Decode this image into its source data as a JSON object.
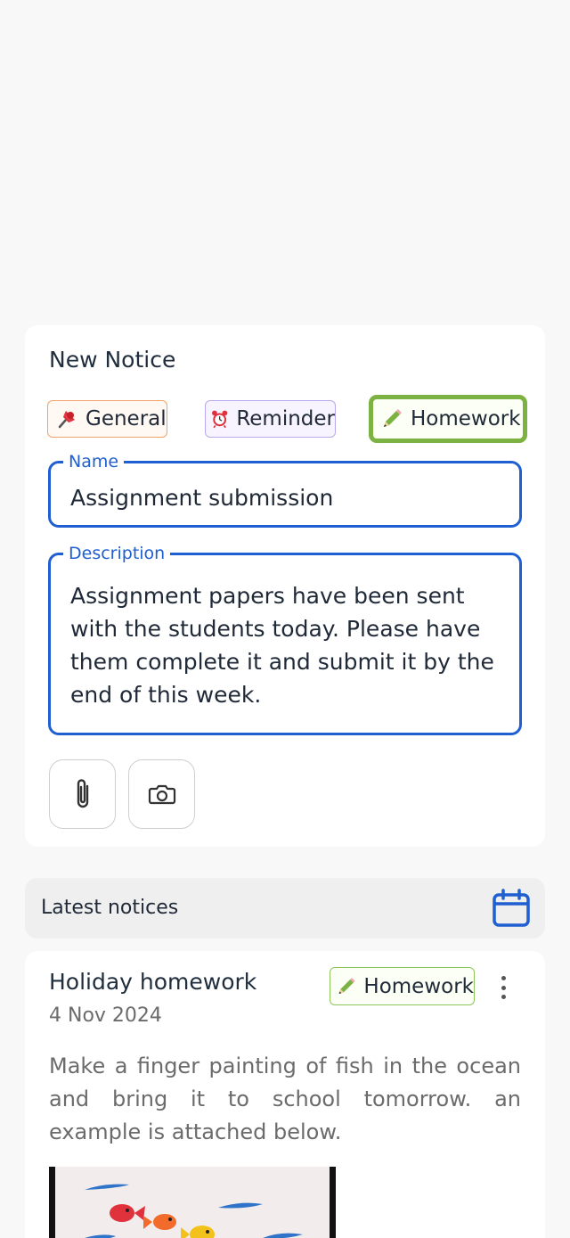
{
  "new_notice": {
    "title": "New Notice",
    "categories": [
      {
        "label": "General",
        "icon": "pushpin-icon",
        "color": "#f0a36b"
      },
      {
        "label": "Reminder",
        "icon": "alarm-clock-icon",
        "color": "#b9a9ee"
      },
      {
        "label": "Homework",
        "icon": "pencil-icon",
        "color": "#7bb241",
        "selected": true
      }
    ],
    "name_field": {
      "label": "Name",
      "value": "Assignment submission"
    },
    "description_field": {
      "label": "Description",
      "value": "Assignment papers have been sent with the students today. Please have them complete it and submit it by the end of this week."
    },
    "attachments": [
      "paperclip-icon",
      "camera-icon"
    ]
  },
  "latest": {
    "label": "Latest notices",
    "calendar_icon": "calendar-icon"
  },
  "notices": [
    {
      "title": "Holiday homework",
      "date": "4 Nov 2024",
      "category": "Homework",
      "category_icon": "pencil-icon",
      "text": "Make a finger painting of fish in the ocean and bring it to school tomorrow. an example is attached below."
    }
  ],
  "colors": {
    "accent": "#1f5fd1",
    "homework": "#7bb241",
    "general": "#f0a36b",
    "reminder": "#b9a9ee"
  }
}
